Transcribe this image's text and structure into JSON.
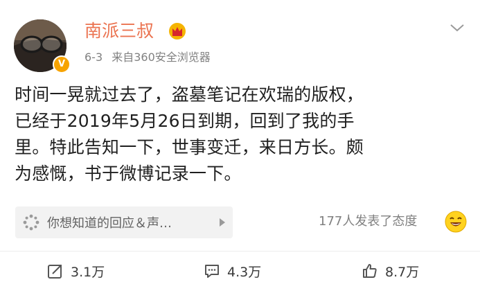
{
  "user": {
    "name": "南派三叔",
    "verified_badge": "V"
  },
  "post": {
    "date": "6-3",
    "source": "来自360安全浏览器",
    "lines": [
      "时间一晃就过去了，盗墓笔记在欢瑞的版权，",
      "已经于2019年5月26日到期，回到了我的手",
      "里。特此告知一下，世事变迁，来日方长。颇",
      "为感慨，书于微博记录一下。"
    ]
  },
  "reactions": {
    "prompt": "你想知道的回应＆声…",
    "attitude_summary": "177人发表了态度"
  },
  "actions": {
    "repost": "3.1万",
    "comment": "4.3万",
    "like": "8.7万"
  },
  "colors": {
    "username": "#eb7350",
    "meta": "#808080",
    "badge": "#f7a300",
    "pill_bg": "#f2f2f2"
  },
  "icons": [
    "avatar",
    "crown-icon",
    "chevron-down-icon",
    "sparkle-icon",
    "play-arrow-icon",
    "smiley-emoji-icon",
    "repost-icon",
    "comment-icon",
    "like-icon"
  ]
}
